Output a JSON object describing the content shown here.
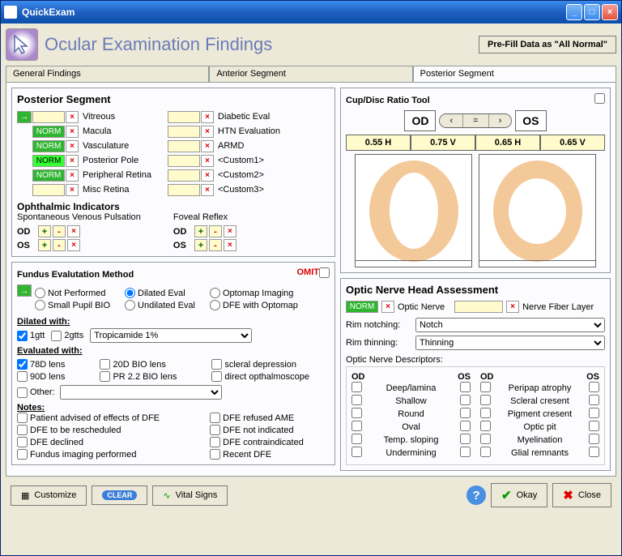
{
  "window": {
    "title": "QuickExam"
  },
  "header": {
    "title": "Ocular Examination Findings",
    "prefill": "Pre-Fill Data as \"All Normal\""
  },
  "tabs": [
    "General Findings",
    "Anterior Segment",
    "Posterior Segment"
  ],
  "posterior": {
    "title": "Posterior Segment",
    "items_left": [
      "Vitreous",
      "Macula",
      "Vasculature",
      "Posterior Pole",
      "Peripheral Retina",
      "Misc Retina"
    ],
    "items_right": [
      "Diabetic Eval",
      "HTN Evaluation",
      "ARMD",
      "<Custom1>",
      "<Custom2>",
      "<Custom3>"
    ],
    "norm": "NORM"
  },
  "ophth": {
    "title": "Ophthalmic Indicators",
    "svp": "Spontaneous Venous Pulsation",
    "foveal": "Foveal Reflex",
    "od": "OD",
    "os": "OS"
  },
  "fundus": {
    "title": "Fundus Evalutation Method",
    "omit": "OMIT",
    "radios": [
      "Not Performed",
      "Dilated Eval",
      "Optomap Imaging",
      "Small Pupil BIO",
      "Undilated Eval",
      "DFE with Optomap"
    ],
    "dilated_with": "Dilated with:",
    "gtt1": "1gtt",
    "gtt2": "2gtts",
    "dilating_agent": "Tropicamide 1%",
    "eval_with": "Evaluated with:",
    "lenses": [
      "78D lens",
      "20D BIO lens",
      "scleral depression",
      "90D lens",
      "PR 2.2 BIO lens",
      "direct opthalmoscope"
    ],
    "other": "Other:",
    "notes_title": "Notes:",
    "notes": [
      "Patient advised of effects of DFE",
      "DFE refused AME",
      "DFE to be rescheduled",
      "DFE not indicated",
      "DFE declined",
      "DFE contraindicated",
      "Fundus imaging performed",
      "Recent DFE"
    ]
  },
  "cupdisc": {
    "title": "Cup/Disc Ratio Tool",
    "od": "OD",
    "os": "OS",
    "vals": [
      "0.55 H",
      "0.75 V",
      "0.65 H",
      "0.65 V"
    ]
  },
  "onh": {
    "title": "Optic Nerve Head Assessment",
    "optic_nerve": "Optic Nerve",
    "nfl": "Nerve Fiber Layer",
    "rim_notching": "Rim notching:",
    "notch_val": "Notch",
    "rim_thinning": "Rim thinning:",
    "thin_val": "Thinning",
    "desc_title": "Optic Nerve Descriptors:",
    "od": "OD",
    "os": "OS",
    "desc_left": [
      "Deep/lamina",
      "Shallow",
      "Round",
      "Oval",
      "Temp. sloping",
      "Undermining"
    ],
    "desc_right": [
      "Peripap atrophy",
      "Scleral cresent",
      "Pigment cresent",
      "Optic pit",
      "Myelination",
      "Glial remnants"
    ]
  },
  "footer": {
    "customize": "Customize",
    "clear": "CLEAR",
    "vitals": "Vital Signs",
    "okay": "Okay",
    "close": "Close"
  }
}
